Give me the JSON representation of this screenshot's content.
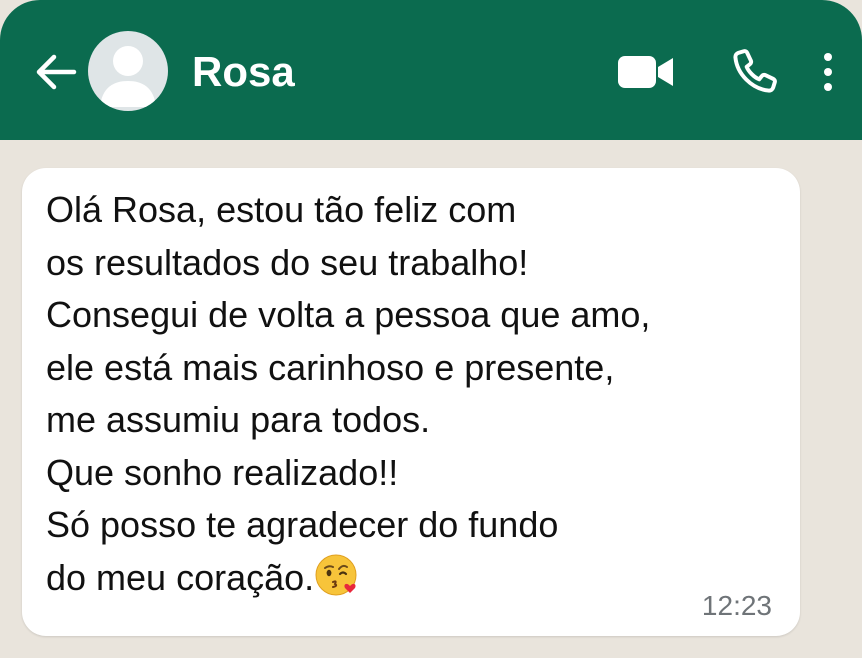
{
  "header": {
    "contact_name": "Rosa",
    "icons": [
      "back-arrow-icon",
      "avatar",
      "video-call-icon",
      "voice-call-icon",
      "more-options-icon"
    ]
  },
  "message": {
    "lines": [
      "Olá Rosa, estou tão feliz com",
      "os resultados do seu trabalho!",
      "Consegui de volta a pessoa que amo,",
      "ele está mais carinhoso e presente,",
      "me assumiu para todos.",
      "Que sonho realizado!!",
      "Só posso te agradecer  do fundo",
      "do meu coração."
    ],
    "emoji": "face-blowing-kiss-emoji",
    "time": "12:23"
  },
  "colors": {
    "header_bg": "#0b6b4f",
    "chat_bg": "#e9e4dc",
    "bubble_bg": "#ffffff",
    "text": "#111111",
    "time": "#6f7478"
  }
}
